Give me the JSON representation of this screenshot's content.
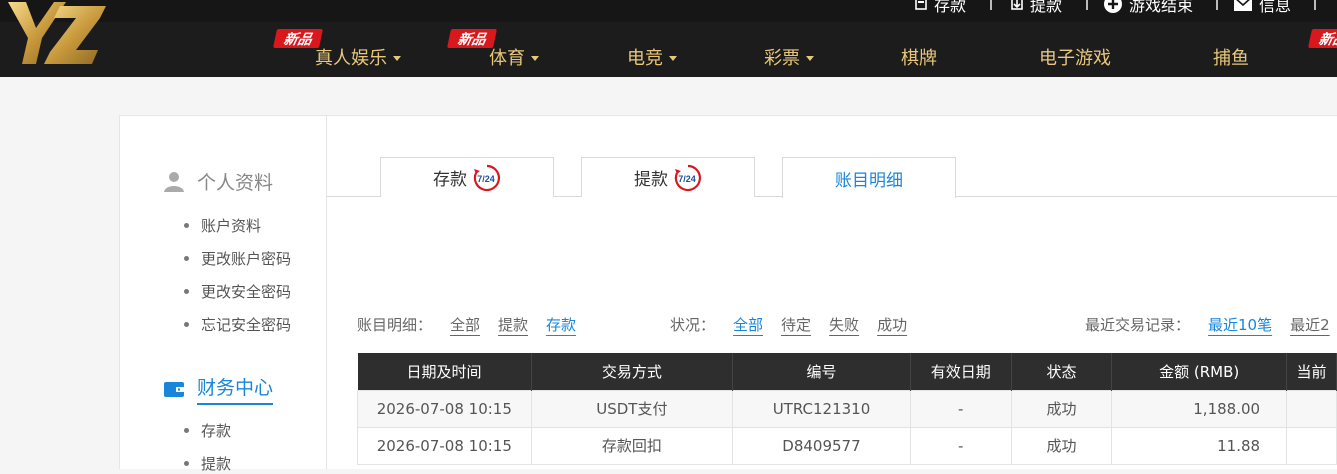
{
  "header": {
    "util": [
      {
        "label": "存款",
        "icon": "deposit-icon"
      },
      {
        "label": "提款",
        "icon": "withdraw-icon"
      },
      {
        "label": "游戏结束",
        "icon": "plus-circle-icon"
      },
      {
        "label": "信息",
        "icon": "mail-icon"
      }
    ],
    "logo_text": "YZ",
    "nav": [
      {
        "label": "真人娱乐",
        "dropdown": true,
        "badge": "新品"
      },
      {
        "label": "体育",
        "dropdown": true,
        "badge": "新品"
      },
      {
        "label": "电竞",
        "dropdown": true
      },
      {
        "label": "彩票",
        "dropdown": true
      },
      {
        "label": "棋牌",
        "dropdown": false
      },
      {
        "label": "电子游戏",
        "dropdown": false
      },
      {
        "label": "捕鱼",
        "dropdown": false,
        "badge": "新品"
      }
    ]
  },
  "sidebar": {
    "profile_title": "个人资料",
    "profile_items": [
      "账户资料",
      "更改账户密码",
      "更改安全密码",
      "忘记安全密码"
    ],
    "finance_title": "财务中心",
    "finance_items": [
      "存款",
      "提款"
    ]
  },
  "tabs": [
    {
      "label": "存款",
      "badge": "7/24"
    },
    {
      "label": "提款",
      "badge": "7/24"
    },
    {
      "label": "账目明细",
      "active": true
    }
  ],
  "filters": {
    "detail_label": "账目明细：",
    "detail_options": [
      "全部",
      "提款",
      "存款"
    ],
    "detail_selected": "存款",
    "status_label": "状况：",
    "status_options": [
      "全部",
      "待定",
      "失败",
      "成功"
    ],
    "status_selected": "全部",
    "recent_label": "最近交易记录：",
    "recent_options": [
      "最近10笔",
      "最近2"
    ],
    "recent_selected": "最近10笔"
  },
  "table": {
    "columns": [
      "日期及时间",
      "交易方式",
      "编号",
      "有效日期",
      "状态",
      "金额 (RMB)",
      "当前"
    ],
    "rows": [
      [
        "2026-07-08 10:15",
        "USDT支付",
        "UTRC121310",
        "-",
        "成功",
        "1,188.00",
        ""
      ],
      [
        "2026-07-08 10:15",
        "存款回扣",
        "D8409577",
        "-",
        "成功",
        "11.88",
        ""
      ]
    ]
  },
  "colors": {
    "accent": "#1a86d9",
    "gold": "#e8c77a",
    "header_bg": "#1c1c1c",
    "badge_red": "#d8181c"
  }
}
